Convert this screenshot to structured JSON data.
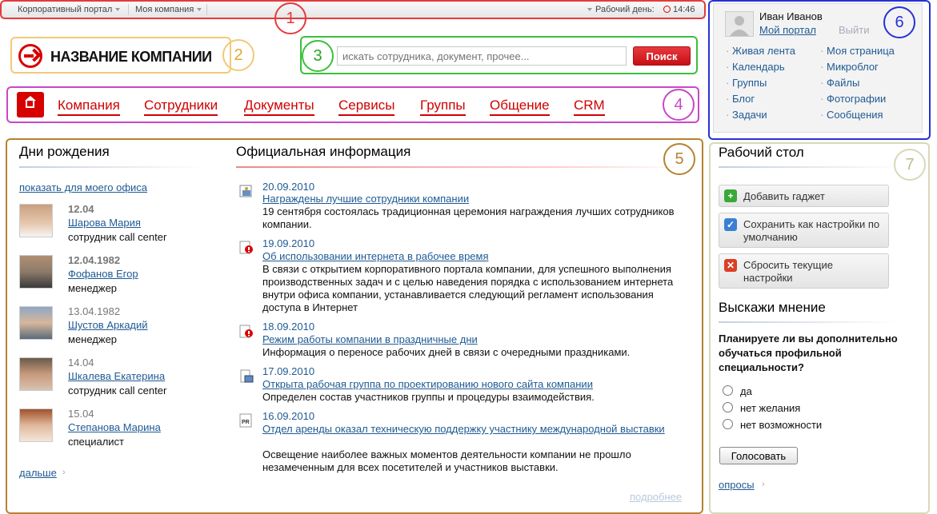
{
  "topbar": {
    "portal_menu": "Корпоративный портал",
    "company_menu": "Моя компания",
    "workday_label": "Рабочий день:",
    "time": "14:46"
  },
  "annotations": [
    "1",
    "2",
    "3",
    "4",
    "5",
    "6",
    "7"
  ],
  "logo": {
    "text": "НАЗВАНИЕ КОМПАНИИ"
  },
  "search": {
    "placeholder": "искать сотрудника, документ, прочее...",
    "button": "Поиск"
  },
  "menu": [
    "Компания",
    "Сотрудники",
    "Документы",
    "Сервисы",
    "Группы",
    "Общение",
    "CRM"
  ],
  "birthdays": {
    "title": "Дни рождения",
    "show_office_link": "показать для моего офиса",
    "people": [
      {
        "date": "12.04",
        "name": "Шарова Мария",
        "position": "сотрудник call center"
      },
      {
        "date": "12.04.1982",
        "name": "Фофанов Егор",
        "position": "менеджер"
      },
      {
        "date": "13.04.1982",
        "name": "Шустов Аркадий",
        "position": "менеджер"
      },
      {
        "date": "14.04",
        "name": "Шкалева Екатерина",
        "position": "сотрудник call center"
      },
      {
        "date": "15.04",
        "name": "Степанова Марина",
        "position": "специалист"
      }
    ],
    "more_link": "дальше"
  },
  "official": {
    "title": "Официальная информация",
    "items": [
      {
        "date": "20.09.2010",
        "title": "Награждены лучшие сотрудники компании",
        "text": "19 сентября состоялась традиционная церемония награждения лучших сотрудников компании.",
        "icon": "award-icon"
      },
      {
        "date": "19.09.2010",
        "title": "Об использовании интернета в рабочее время",
        "text": "В связи с открытием корпоративного портала компании, для успешного выполнения производственных задач и с целью наведения порядка с использованием интернета внутри офиса компании, устанавливается следующий регламент использования доступа в Интернет",
        "icon": "important-icon"
      },
      {
        "date": "18.09.2010",
        "title": "Режим работы компании в праздничные дни",
        "text": "Информация о переносе рабочих дней в связи с очередными праздниками.",
        "icon": "important-icon"
      },
      {
        "date": "17.09.2010",
        "title": "Открыта рабочая группа по проектированию нового сайта компании",
        "text": "Определен состав участников группы и процедуры взаимодействия.",
        "icon": "computer-icon"
      },
      {
        "date": "16.09.2010",
        "title": "Отдел аренды оказал техническую поддержку участнику международной выставки",
        "text": "Освещение наиболее важных моментов деятельности компании не прошло незамеченным для всех посетителей и участников выставки.",
        "icon": "pr-icon"
      }
    ],
    "more_link": "подробнее"
  },
  "user": {
    "name": "Иван Иванов",
    "portal_link": "Мой портал",
    "logout": "Выйти",
    "links_left": [
      "Живая лента",
      "Календарь",
      "Группы",
      "Блог",
      "Задачи"
    ],
    "links_right": [
      "Моя страница",
      "Микроблог",
      "Файлы",
      "Фотографии",
      "Сообщения"
    ]
  },
  "desktop": {
    "title": "Рабочий стол",
    "add_gadget": "Добавить гаджет",
    "save_default": "Сохранить как настройки по умолчанию",
    "reset": "Сбросить текущие настройки"
  },
  "poll": {
    "title": "Выскажи мнение",
    "question": "Планируете ли вы дополнительно обучаться профильной специальности?",
    "options": [
      "да",
      "нет желания",
      "нет возможности"
    ],
    "vote_button": "Голосовать",
    "polls_link": "опросы"
  },
  "colors": {
    "accent_red": "#d00000",
    "link": "#1f5a93"
  }
}
